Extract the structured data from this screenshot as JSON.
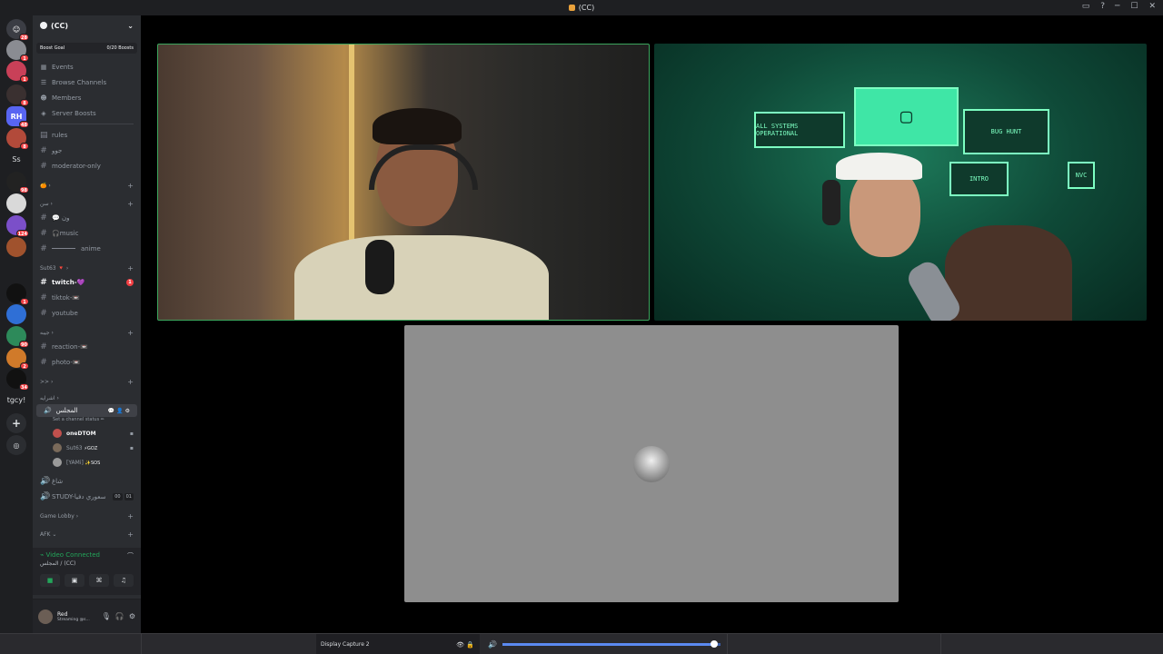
{
  "window": {
    "title": "(CC)"
  },
  "guild": {
    "name": "(CC)"
  },
  "boost": {
    "label": "Boost Goal",
    "progress_text": "0/20 Boosts",
    "progress_fraction": 0.0
  },
  "server_rail": {
    "badges": [
      "28",
      "1",
      "1",
      "8",
      "1",
      "48",
      "8",
      "98",
      "1",
      "124",
      "1",
      "90",
      "1",
      "2",
      "1",
      "34"
    ],
    "texts": [
      "Ss",
      "tgcy!"
    ]
  },
  "nav": [
    {
      "icon": "calendar-icon",
      "label": "Events"
    },
    {
      "icon": "browse-icon",
      "label": "Browse Channels"
    },
    {
      "icon": "members-icon",
      "label": "Members"
    },
    {
      "icon": "boost-icon",
      "label": "Server Boosts"
    }
  ],
  "channels_top": [
    {
      "label": "rules",
      "unread": false
    },
    {
      "label": "جوو",
      "unread": false
    },
    {
      "label": "moderator-only",
      "unread": false
    }
  ],
  "cat1": {
    "label": "🍊 ›"
  },
  "cat2": {
    "label": "سن ›"
  },
  "channels_mid": [
    {
      "label": "💬 ون",
      "unread": false
    },
    {
      "label": "🎧music",
      "unread": false
    },
    {
      "label": "anime",
      "unread": false
    }
  ],
  "cat3": {
    "label": "Sut63 🔻 ›"
  },
  "channels_sut": [
    {
      "label": "twitch-💜",
      "unread": true,
      "mention": "1"
    },
    {
      "label": "tiktok-📼",
      "unread": false
    },
    {
      "label": "youtube",
      "unread": false
    }
  ],
  "cat4": {
    "label": "جيبه ›"
  },
  "channels_photo": [
    {
      "label": "reaction-📼",
      "unread": false
    },
    {
      "label": "photo-📼",
      "unread": false
    }
  ],
  "cat5": {
    "label": ">> ›"
  },
  "cat6": {
    "label": "اشرايه ›"
  },
  "voice": {
    "channel": "المجلس",
    "status": "Set a channel status ✏",
    "users": [
      {
        "name": "oneDTOM",
        "tag": "",
        "bold": true
      },
      {
        "name": "Sut63",
        "tag": "⚡GOZ",
        "bold": false
      },
      {
        "name": "[YAMi]",
        "tag": "✨SOS",
        "bold": false
      }
    ]
  },
  "voice_more": [
    {
      "label": "شاغ"
    },
    {
      "label": "STUDY-سعوري دفيا",
      "timer": [
        "00",
        "01"
      ]
    }
  ],
  "cat7": {
    "label": "Game Lobby ›"
  },
  "cat8": {
    "label": "AFK ⌄"
  },
  "voice_panel": {
    "status": "Video Connected",
    "location": "المجلس / (CC)"
  },
  "user": {
    "name": "Red",
    "status": "Streaming @s..."
  },
  "stage": {
    "tile_b_screens": [
      "ALL SYSTEMS OPERATIONAL",
      "BUG HUNT",
      "INTRO",
      "NVC"
    ]
  },
  "obs": {
    "source_label": "Display Capture 2",
    "volume_fraction": 0.97
  }
}
